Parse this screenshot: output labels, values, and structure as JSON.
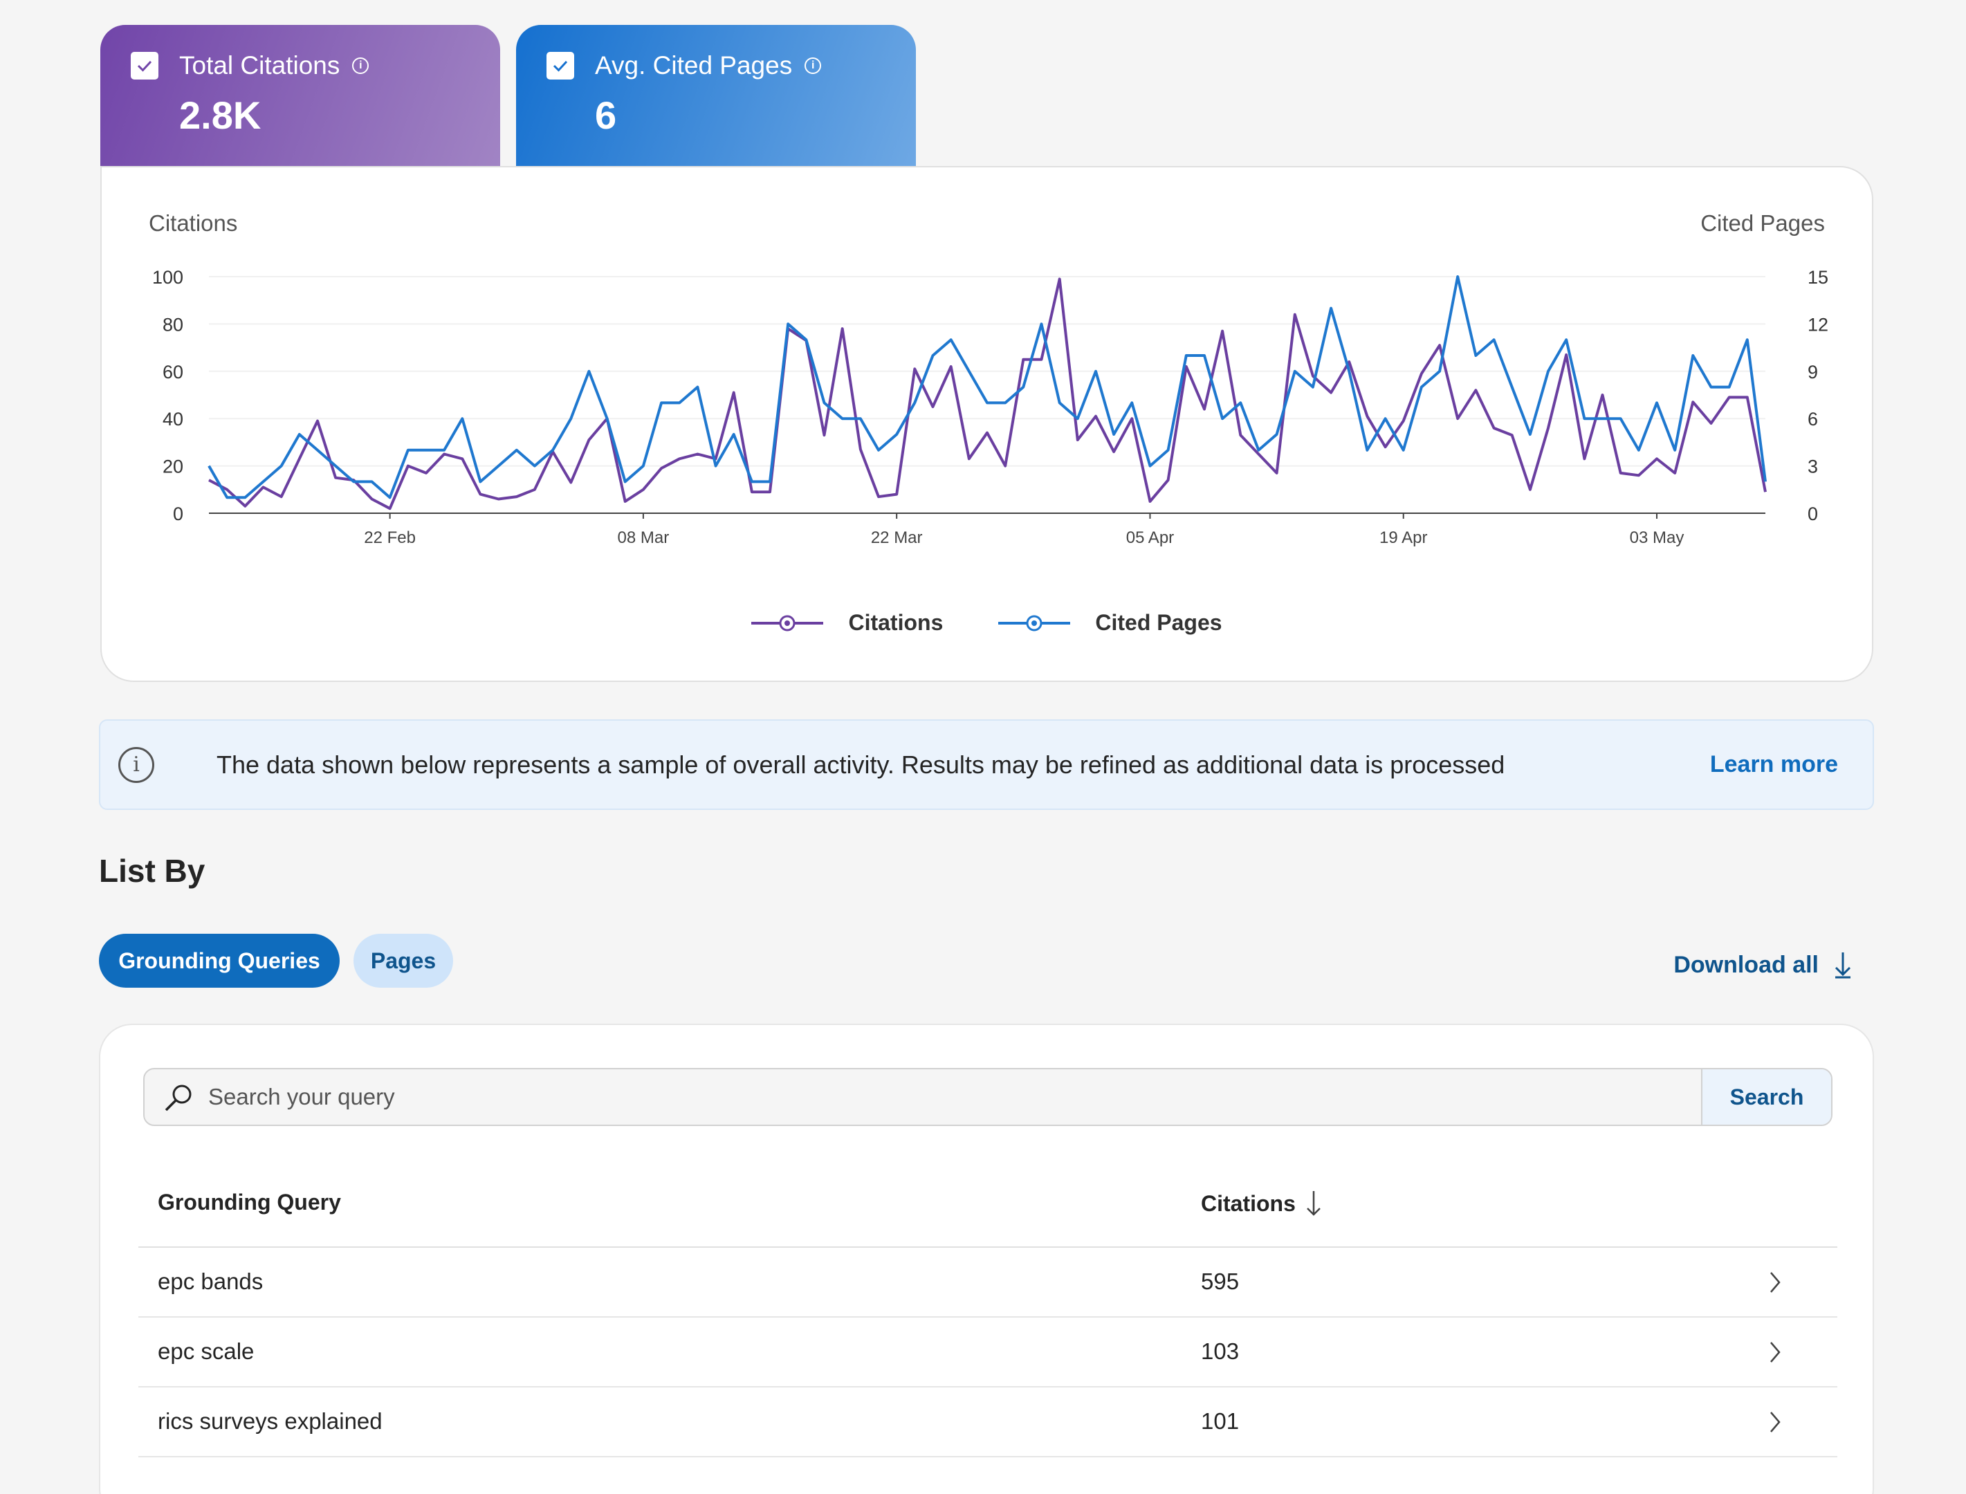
{
  "kpis": [
    {
      "label": "Total Citations",
      "value": "2.8K",
      "color": "#7145a9"
    },
    {
      "label": "Avg. Cited Pages",
      "value": "6",
      "color": "#1570cf"
    }
  ],
  "chart_data": {
    "type": "line",
    "y_left_label": "Citations",
    "y_right_label": "Cited Pages",
    "y_left_ticks": [
      "0",
      "20",
      "40",
      "60",
      "80",
      "100"
    ],
    "y_right_ticks": [
      "0",
      "3",
      "6",
      "9",
      "12",
      "15"
    ],
    "ylim_left": [
      0,
      100
    ],
    "ylim_right": [
      0,
      15
    ],
    "x_tick_labels": [
      "22 Feb",
      "08 Mar",
      "22 Mar",
      "05 Apr",
      "19 Apr",
      "03 May"
    ],
    "x_tick_index": [
      10,
      24,
      38,
      52,
      66,
      80
    ],
    "grid": true,
    "legend_position": "bottom",
    "series": [
      {
        "name": "Citations",
        "axis": "left",
        "color": "#6a3fa0",
        "values": [
          14,
          10,
          3,
          11,
          7,
          23,
          39,
          15,
          14,
          6,
          2,
          20,
          17,
          25,
          23,
          8,
          6,
          7,
          10,
          26,
          13,
          31,
          40,
          5,
          10,
          19,
          23,
          25,
          23,
          51,
          9,
          9,
          78,
          73,
          33,
          78,
          27,
          7,
          8,
          61,
          45,
          62,
          23,
          34,
          20,
          65,
          65,
          99,
          31,
          41,
          26,
          40,
          5,
          14,
          62,
          44,
          77,
          33,
          25,
          17,
          84,
          58,
          51,
          64,
          41,
          28,
          39,
          59,
          71,
          40,
          52,
          36,
          33,
          10,
          36,
          67,
          23,
          50,
          17,
          16,
          23,
          17,
          47,
          38,
          49,
          49,
          9
        ],
        "min_label": "",
        "max_label": ""
      },
      {
        "name": "Cited Pages",
        "axis": "right",
        "color": "#1f78cf",
        "values": [
          3,
          1,
          1,
          2,
          3,
          5,
          4,
          3,
          2,
          2,
          1,
          4,
          4,
          4,
          6,
          2,
          3,
          4,
          3,
          4,
          6,
          9,
          6,
          2,
          3,
          7,
          7,
          8,
          3,
          5,
          2,
          2,
          12,
          11,
          7,
          6,
          6,
          4,
          5,
          7,
          10,
          11,
          9,
          7,
          7,
          8,
          12,
          7,
          6,
          9,
          5,
          7,
          3,
          4,
          10,
          10,
          6,
          7,
          4,
          5,
          9,
          8,
          13,
          9,
          4,
          6,
          4,
          8,
          9,
          15,
          10,
          11,
          8,
          5,
          9,
          11,
          6,
          6,
          6,
          4,
          7,
          4,
          10,
          8,
          8,
          11,
          2
        ]
      }
    ]
  },
  "banner": {
    "message": "The data shown below represents a sample of overall activity. Results may be refined as additional data is processed",
    "link": "Learn more"
  },
  "list_by": {
    "heading": "List By",
    "tabs": [
      "Grounding Queries",
      "Pages"
    ],
    "download_label": "Download all"
  },
  "search": {
    "placeholder": "Search your query",
    "button": "Search"
  },
  "table": {
    "headers": {
      "query": "Grounding Query",
      "citations": "Citations"
    },
    "rows": [
      {
        "query": "epc bands",
        "citations": "595"
      },
      {
        "query": "epc scale",
        "citations": "103"
      },
      {
        "query": "rics surveys explained",
        "citations": "101"
      }
    ]
  }
}
